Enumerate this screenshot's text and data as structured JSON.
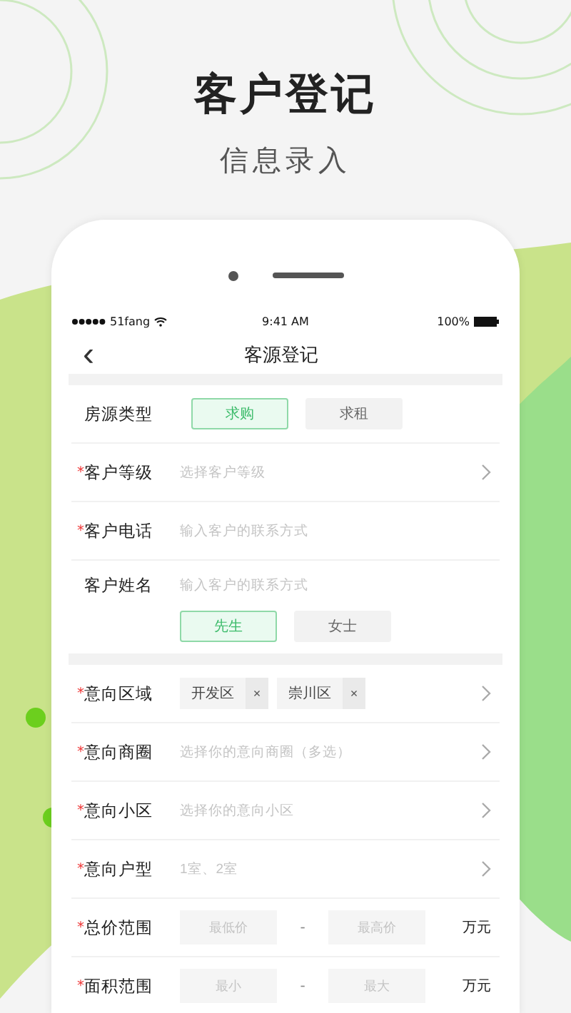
{
  "header": {
    "title": "客户登记",
    "subtitle": "信息录入"
  },
  "status_bar": {
    "carrier": "51fang",
    "time": "9:41 AM",
    "battery": "100%"
  },
  "nav": {
    "back": "‹",
    "title": "客源登记"
  },
  "sections": [
    {
      "rows": [
        {
          "kind": "toggle",
          "label": "房源类型",
          "options": [
            {
              "label": "求购",
              "selected": true
            },
            {
              "label": "求租",
              "selected": false
            }
          ]
        },
        {
          "kind": "select",
          "label": "客户等级",
          "required_mark": "*",
          "placeholder": "选择客户等级"
        },
        {
          "kind": "input",
          "label": "客户电话",
          "required_mark": "*",
          "placeholder": "输入客户的联系方式"
        },
        {
          "kind": "name",
          "label": "客户姓名",
          "placeholder": "输入客户的联系方式",
          "options": [
            {
              "label": "先生",
              "selected": true
            },
            {
              "label": "女士",
              "selected": false
            }
          ]
        }
      ]
    },
    {
      "rows": [
        {
          "kind": "tags",
          "label": "意向区域",
          "required_mark": "*",
          "tags": [
            {
              "label": "开发区",
              "remove": "×"
            },
            {
              "label": "崇川区",
              "remove": "×"
            }
          ]
        },
        {
          "kind": "select",
          "label": "意向商圈",
          "required_mark": "*",
          "placeholder": "选择你的意向商圈（多选）"
        },
        {
          "kind": "select",
          "label": "意向小区",
          "required_mark": "*",
          "placeholder": "选择你的意向小区"
        },
        {
          "kind": "select",
          "label": "意向户型",
          "required_mark": "*",
          "placeholder": "1室、2室"
        },
        {
          "kind": "range",
          "label": "总价范围",
          "required_mark": "*",
          "min_placeholder": "最低价",
          "separator": "-",
          "max_placeholder": "最高价",
          "unit": "万元"
        },
        {
          "kind": "range",
          "label": "面积范围",
          "required_mark": "*",
          "min_placeholder": "最小",
          "separator": "-",
          "max_placeholder": "最大",
          "unit": "万元"
        }
      ]
    }
  ]
}
